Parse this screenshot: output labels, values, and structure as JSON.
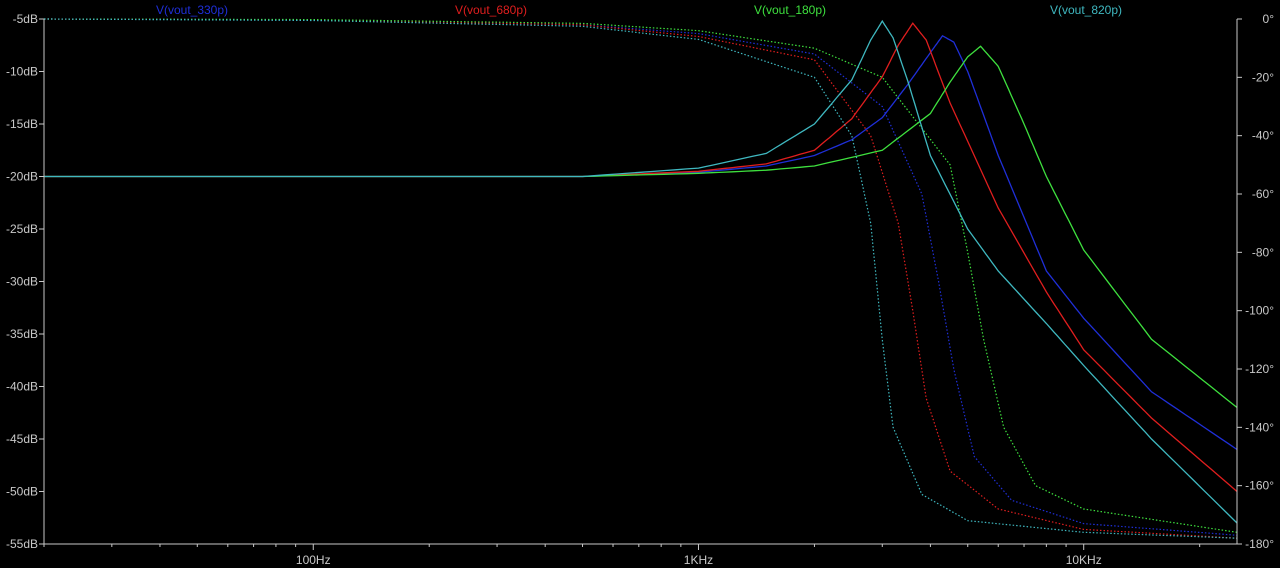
{
  "chart_data": {
    "type": "line",
    "title": "",
    "xlabel": "",
    "ylabel": "",
    "x_scale": "log",
    "xlim": [
      20,
      25000
    ],
    "ylim": [
      -55,
      -5
    ],
    "y2lim": [
      -180,
      0
    ],
    "y2_unit": "degrees (phase)",
    "grid": false,
    "background": "#000000",
    "legend": "top",
    "x_ticks": [
      {
        "value": 100,
        "label": "100Hz"
      },
      {
        "value": 1000,
        "label": "1KHz"
      },
      {
        "value": 10000,
        "label": "10KHz"
      }
    ],
    "y_ticks": [
      {
        "value": -5,
        "label": "-5dB"
      },
      {
        "value": -10,
        "label": "-10dB"
      },
      {
        "value": -15,
        "label": "-15dB"
      },
      {
        "value": -20,
        "label": "-20dB"
      },
      {
        "value": -25,
        "label": "-25dB"
      },
      {
        "value": -30,
        "label": "-30dB"
      },
      {
        "value": -35,
        "label": "-35dB"
      },
      {
        "value": -40,
        "label": "-40dB"
      },
      {
        "value": -45,
        "label": "-45dB"
      },
      {
        "value": -50,
        "label": "-50dB"
      },
      {
        "value": -55,
        "label": "-55dB"
      }
    ],
    "y2_ticks": [
      {
        "value": 0,
        "label": "0°"
      },
      {
        "value": -20,
        "label": "-20°"
      },
      {
        "value": -40,
        "label": "-40°"
      },
      {
        "value": -60,
        "label": "-60°"
      },
      {
        "value": -80,
        "label": "-80°"
      },
      {
        "value": -100,
        "label": "-100°"
      },
      {
        "value": -120,
        "label": "-120°"
      },
      {
        "value": -140,
        "label": "-140°"
      },
      {
        "value": -160,
        "label": "-160°"
      },
      {
        "value": -180,
        "label": "-180°"
      }
    ],
    "series": [
      {
        "name": "V(vout_330p)",
        "color": "#1f2fd8",
        "magnitude_db": [
          [
            20,
            -20
          ],
          [
            100,
            -20
          ],
          [
            500,
            -20
          ],
          [
            1000,
            -19.6
          ],
          [
            1500,
            -19
          ],
          [
            2000,
            -18
          ],
          [
            2500,
            -16.5
          ],
          [
            3000,
            -14.4
          ],
          [
            3500,
            -11.2
          ],
          [
            4000,
            -8.2
          ],
          [
            4300,
            -6.6
          ],
          [
            4600,
            -7.2
          ],
          [
            5000,
            -10
          ],
          [
            6000,
            -18
          ],
          [
            8000,
            -29
          ],
          [
            10000,
            -33.5
          ],
          [
            15000,
            -40.5
          ],
          [
            25000,
            -46
          ]
        ],
        "phase_deg": [
          [
            20,
            0
          ],
          [
            100,
            -0.3
          ],
          [
            500,
            -2
          ],
          [
            1000,
            -5
          ],
          [
            2000,
            -12
          ],
          [
            3000,
            -30
          ],
          [
            3800,
            -60
          ],
          [
            4200,
            -90
          ],
          [
            4600,
            -120
          ],
          [
            5200,
            -150
          ],
          [
            6500,
            -165
          ],
          [
            10000,
            -173
          ],
          [
            25000,
            -177
          ]
        ]
      },
      {
        "name": "V(vout_680p)",
        "color": "#e01e1e",
        "magnitude_db": [
          [
            20,
            -20
          ],
          [
            100,
            -20
          ],
          [
            500,
            -20
          ],
          [
            1000,
            -19.5
          ],
          [
            1500,
            -18.8
          ],
          [
            2000,
            -17.5
          ],
          [
            2500,
            -14.5
          ],
          [
            3000,
            -10.5
          ],
          [
            3300,
            -7.5
          ],
          [
            3600,
            -5.4
          ],
          [
            3900,
            -7
          ],
          [
            4500,
            -13
          ],
          [
            6000,
            -23
          ],
          [
            8000,
            -31
          ],
          [
            10000,
            -36.5
          ],
          [
            15000,
            -43
          ],
          [
            25000,
            -50
          ]
        ],
        "phase_deg": [
          [
            20,
            0
          ],
          [
            100,
            -0.3
          ],
          [
            500,
            -2
          ],
          [
            1000,
            -6
          ],
          [
            2000,
            -14
          ],
          [
            2800,
            -40
          ],
          [
            3300,
            -70
          ],
          [
            3600,
            -100
          ],
          [
            3900,
            -130
          ],
          [
            4500,
            -155
          ],
          [
            6000,
            -168
          ],
          [
            10000,
            -175
          ],
          [
            25000,
            -178
          ]
        ]
      },
      {
        "name": "V(vout_180p)",
        "color": "#3ee03e",
        "magnitude_db": [
          [
            20,
            -20
          ],
          [
            100,
            -20
          ],
          [
            500,
            -20
          ],
          [
            1000,
            -19.7
          ],
          [
            1500,
            -19.4
          ],
          [
            2000,
            -19
          ],
          [
            3000,
            -17.5
          ],
          [
            4000,
            -14
          ],
          [
            4500,
            -11
          ],
          [
            5000,
            -8.6
          ],
          [
            5400,
            -7.6
          ],
          [
            6000,
            -9.5
          ],
          [
            7000,
            -15
          ],
          [
            8000,
            -20
          ],
          [
            10000,
            -27
          ],
          [
            15000,
            -35.5
          ],
          [
            25000,
            -42
          ]
        ],
        "phase_deg": [
          [
            20,
            0
          ],
          [
            100,
            -0.2
          ],
          [
            500,
            -1.5
          ],
          [
            1000,
            -4
          ],
          [
            2000,
            -10
          ],
          [
            3000,
            -20
          ],
          [
            4500,
            -50
          ],
          [
            5000,
            -80
          ],
          [
            5500,
            -110
          ],
          [
            6200,
            -140
          ],
          [
            7500,
            -160
          ],
          [
            10000,
            -168
          ],
          [
            25000,
            -176
          ]
        ]
      },
      {
        "name": "V(vout_820p)",
        "color": "#3fb8c0",
        "magnitude_db": [
          [
            20,
            -20
          ],
          [
            100,
            -20
          ],
          [
            500,
            -20
          ],
          [
            1000,
            -19.2
          ],
          [
            1500,
            -17.8
          ],
          [
            2000,
            -15
          ],
          [
            2500,
            -10.8
          ],
          [
            2800,
            -7
          ],
          [
            3000,
            -5.2
          ],
          [
            3200,
            -6.8
          ],
          [
            3500,
            -11
          ],
          [
            4000,
            -18
          ],
          [
            5000,
            -25
          ],
          [
            6000,
            -29
          ],
          [
            8000,
            -34
          ],
          [
            10000,
            -38
          ],
          [
            15000,
            -45
          ],
          [
            25000,
            -53
          ]
        ],
        "phase_deg": [
          [
            20,
            0
          ],
          [
            100,
            -0.5
          ],
          [
            500,
            -2.5
          ],
          [
            1000,
            -7
          ],
          [
            2000,
            -20
          ],
          [
            2500,
            -40
          ],
          [
            2800,
            -70
          ],
          [
            3000,
            -110
          ],
          [
            3200,
            -140
          ],
          [
            3800,
            -163
          ],
          [
            5000,
            -172
          ],
          [
            10000,
            -176
          ],
          [
            25000,
            -178
          ]
        ]
      }
    ]
  }
}
